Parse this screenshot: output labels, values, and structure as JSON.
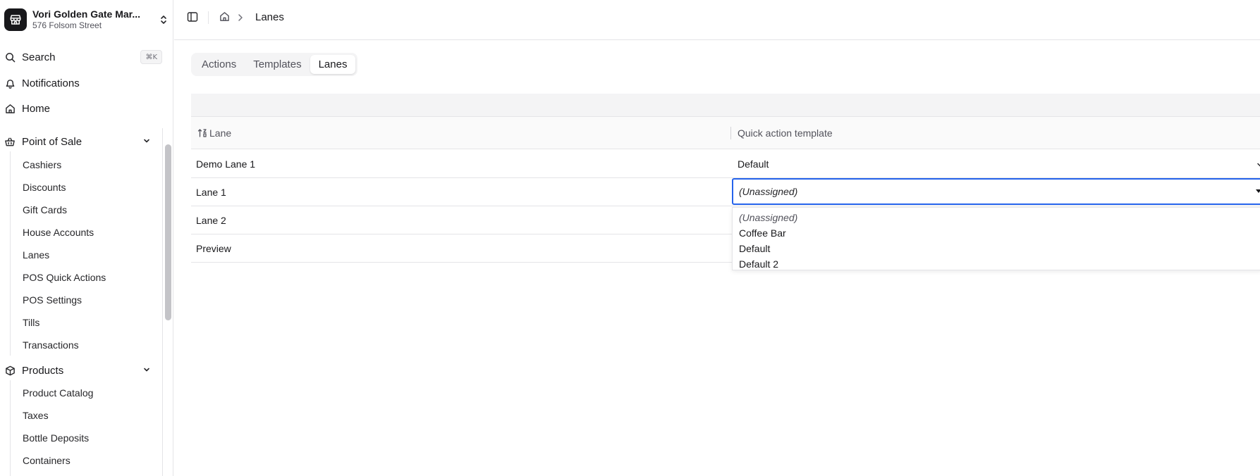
{
  "store": {
    "name": "Vori Golden Gate Mar...",
    "address": "576 Folsom Street"
  },
  "nav": {
    "search_label": "Search",
    "search_shortcut": "⌘K",
    "notifications_label": "Notifications",
    "home_label": "Home"
  },
  "sidebar": {
    "pos_group": {
      "label": "Point of Sale",
      "items": [
        "Cashiers",
        "Discounts",
        "Gift Cards",
        "House Accounts",
        "Lanes",
        "POS Quick Actions",
        "POS Settings",
        "Tills",
        "Transactions"
      ]
    },
    "products_group": {
      "label": "Products",
      "items": [
        "Product Catalog",
        "Taxes",
        "Bottle Deposits",
        "Containers"
      ]
    }
  },
  "breadcrumb": {
    "current": "Lanes"
  },
  "tabs": [
    {
      "label": "Actions",
      "active": false
    },
    {
      "label": "Templates",
      "active": false
    },
    {
      "label": "Lanes",
      "active": true
    }
  ],
  "table": {
    "columns": [
      "Lane",
      "Quick action template"
    ],
    "rows": [
      {
        "lane": "Demo Lane 1",
        "template": "Default"
      },
      {
        "lane": "Lane 1",
        "template": "(Unassigned)"
      },
      {
        "lane": "Lane 2",
        "template": ""
      },
      {
        "lane": "Preview",
        "template": ""
      }
    ]
  },
  "dropdown": {
    "selected": "(Unassigned)",
    "options": [
      "(Unassigned)",
      "Coffee Bar",
      "Default",
      "Default 2"
    ]
  },
  "colors": {
    "focus_ring": "#2563eb",
    "logo_bg": "#18181b"
  }
}
